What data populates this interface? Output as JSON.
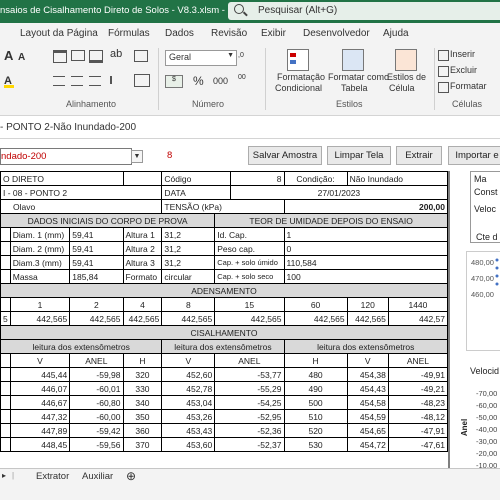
{
  "titlebar": {
    "title": "nsaios de Cisalhamento Direto de Solos - V8.3.xlsm  -  Excel",
    "search_placeholder": "Pesquisar (Alt+G)"
  },
  "menu": [
    "Layout da Página",
    "Fórmulas",
    "Dados",
    "Revisão",
    "Exibir",
    "Desenvolvedor",
    "Ajuda"
  ],
  "ribbon": {
    "font_a_large": "A",
    "font_a_small": "A",
    "number_format": "Geral",
    "percent": "%",
    "thousands": "000",
    "dec_more": ",0",
    "dec_less": "00",
    "cond_format": [
      "Formatação",
      "Condicional"
    ],
    "format_table": [
      "Formatar como",
      "Tabela"
    ],
    "cell_styles": [
      "Estilos de",
      "Célula"
    ],
    "insert": "Inserir",
    "delete": "Excluir",
    "format": "Formatar",
    "groups": {
      "alignment": "Alinhamento",
      "number": "Número",
      "styles": "Estilos",
      "cells": "Células"
    }
  },
  "formula_bar": "- PONTO 2-Não Inundado-200",
  "controls": {
    "combo_value": "ndado-200",
    "count": "8",
    "buttons": [
      "Salvar Amostra",
      "Limpar Tela",
      "Extrair",
      "Importar e"
    ]
  },
  "sheet": {
    "r1": {
      "a": "O DIRETO",
      "codigo": "Código",
      "codigo_v": "8",
      "condicao": "Condição:",
      "condicao_v": "Não Inundado"
    },
    "r2": {
      "a": "I - 08 - PONTO 2",
      "data": "DATA",
      "data_v": "27/01/2023"
    },
    "r3": {
      "a": "Olavo",
      "tensao": "TENSÃO (kPa)",
      "tensao_v": "200,00"
    },
    "r4": {
      "left": "DADOS INICIAIS DO CORPO DE PROVA",
      "right": "TEOR DE UMIDADE DEPOIS DO ENSAIO"
    },
    "init_rows": [
      {
        "l1": "Diam. 1 (mm)",
        "v1": "59,41",
        "l2": "Altura 1",
        "v2": "31,2",
        "l3": "Id. Cap.",
        "v3": "1"
      },
      {
        "l1": "Diam. 2 (mm)",
        "v1": "59,41",
        "l2": "Altura 2",
        "v2": "31,2",
        "l3": "Peso cap.",
        "v3": "0"
      },
      {
        "l1": "Diam.3 (mm)",
        "v1": "59,41",
        "l2": "Altura 3",
        "v2": "31,2",
        "l3": "Cap. + solo úmido",
        "v3": "110,584"
      },
      {
        "l1": "Massa",
        "v1": "185,84",
        "l2": "Formato",
        "v2": "circular",
        "l3": "Cap. + solo seco",
        "v3": "100"
      }
    ],
    "adensamento": "ADENSAMENTO",
    "aden_times": [
      "1",
      "2",
      "4",
      "8",
      "15",
      "60",
      "120",
      "1440"
    ],
    "aden_values": [
      "5",
      "442,565",
      "442,565",
      "442,565",
      "442,565",
      "442,565",
      "442,565",
      "442,565",
      "442,57"
    ],
    "cisalhamento": "CISALHAMENTO",
    "ext_header": [
      "leitura dos extensômetros",
      "leitura dos extensômetros",
      "leitura dos extensômetros"
    ],
    "col_header": [
      "V",
      "ANEL",
      "H",
      "V",
      "ANEL",
      "H",
      "V",
      "ANEL"
    ],
    "rows": [
      [
        "445,44",
        "-59,98",
        "320",
        "452,60",
        "-53,77",
        "480",
        "454,38",
        "-49,91"
      ],
      [
        "446,07",
        "-60,01",
        "330",
        "452,78",
        "-55,29",
        "490",
        "454,43",
        "-49,21"
      ],
      [
        "446,67",
        "-60,80",
        "340",
        "453,04",
        "-54,25",
        "500",
        "454,58",
        "-48,23"
      ],
      [
        "447,32",
        "-60,00",
        "350",
        "453,26",
        "-52,95",
        "510",
        "454,59",
        "-48,12"
      ],
      [
        "447,89",
        "-59,42",
        "360",
        "453,43",
        "-52,36",
        "520",
        "454,65",
        "-47,91"
      ],
      [
        "448,45",
        "-59,56",
        "370",
        "453,60",
        "-52,37",
        "530",
        "454,72",
        "-47,61"
      ]
    ]
  },
  "right_panel": {
    "ma": "Ma",
    "const": "Const",
    "veloc": "Veloc",
    "cte": "Cte d",
    "chart1_ticks": [
      "480,00",
      "470,00",
      "460,00"
    ],
    "veloci": "Velocid",
    "chart2_ticks": [
      "-70,00",
      "-60,00",
      "-50,00",
      "-40,00",
      "-30,00",
      "-20,00",
      "-10,00"
    ],
    "axis_label": "Anel"
  },
  "tabs": [
    "Extrator",
    "Auxiliar"
  ]
}
